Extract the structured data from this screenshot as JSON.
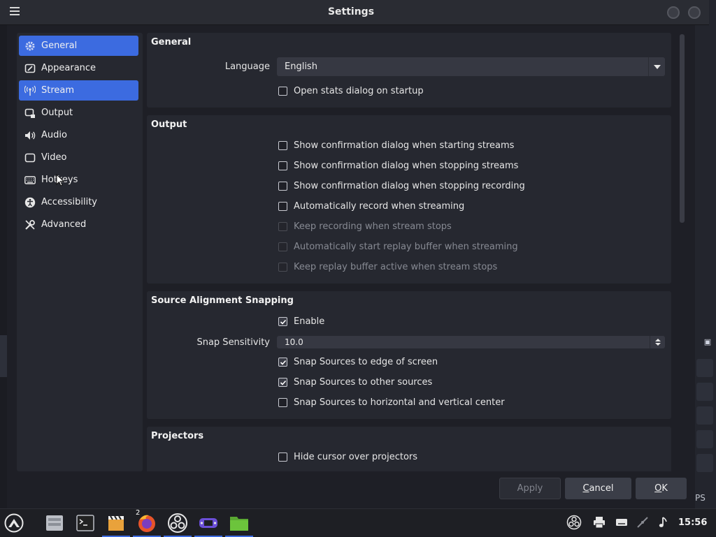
{
  "window": {
    "title": "Settings"
  },
  "sidebar": {
    "items": [
      {
        "label": "General",
        "icon": "gear-icon",
        "active": true
      },
      {
        "label": "Appearance",
        "icon": "appearance-icon",
        "active": false
      },
      {
        "label": "Stream",
        "icon": "stream-antenna-icon",
        "active": true
      },
      {
        "label": "Output",
        "icon": "output-icon",
        "active": false
      },
      {
        "label": "Audio",
        "icon": "speaker-icon",
        "active": false
      },
      {
        "label": "Video",
        "icon": "monitor-icon",
        "active": false
      },
      {
        "label": "Hotkeys",
        "icon": "keyboard-icon",
        "active": false
      },
      {
        "label": "Accessibility",
        "icon": "accessibility-icon",
        "active": false
      },
      {
        "label": "Advanced",
        "icon": "wrench-icon",
        "active": false
      }
    ]
  },
  "general": {
    "title": "General",
    "language_label": "Language",
    "language_value": "English",
    "open_stats_label": "Open stats dialog on startup",
    "open_stats_checked": false
  },
  "output": {
    "title": "Output",
    "options": [
      {
        "label": "Show confirmation dialog when starting streams",
        "checked": false,
        "enabled": true
      },
      {
        "label": "Show confirmation dialog when stopping streams",
        "checked": false,
        "enabled": true
      },
      {
        "label": "Show confirmation dialog when stopping recording",
        "checked": false,
        "enabled": true
      },
      {
        "label": "Automatically record when streaming",
        "checked": false,
        "enabled": true
      },
      {
        "label": "Keep recording when stream stops",
        "checked": false,
        "enabled": false
      },
      {
        "label": "Automatically start replay buffer when streaming",
        "checked": false,
        "enabled": false
      },
      {
        "label": "Keep replay buffer active when stream stops",
        "checked": false,
        "enabled": false
      }
    ]
  },
  "snapping": {
    "title": "Source Alignment Snapping",
    "enable_label": "Enable",
    "enable_checked": true,
    "sensitivity_label": "Snap Sensitivity",
    "sensitivity_value": "10.0",
    "options": [
      {
        "label": "Snap Sources to edge of screen",
        "checked": true
      },
      {
        "label": "Snap Sources to other sources",
        "checked": true
      },
      {
        "label": "Snap Sources to horizontal and vertical center",
        "checked": false
      }
    ]
  },
  "projectors": {
    "title": "Projectors",
    "hide_cursor_label": "Hide cursor over projectors",
    "hide_cursor_checked": false
  },
  "buttons": {
    "apply": "Apply",
    "cancel_prefix": "",
    "cancel_underlined": "C",
    "cancel_rest": "ancel",
    "ok_underlined": "O",
    "ok_rest": "K"
  },
  "taskbar": {
    "firefox_badge": "2",
    "clock": "15:56"
  },
  "background": {
    "partial_text": "PS"
  },
  "colors": {
    "accent": "#3c6be0",
    "panel": "#262830",
    "background": "#1e1f26"
  }
}
